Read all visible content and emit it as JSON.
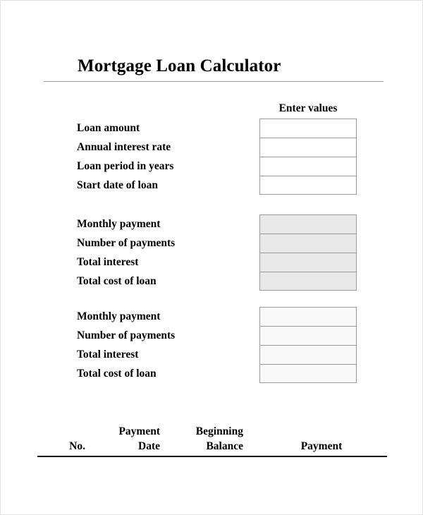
{
  "document": {
    "title": "Mortgage Loan Calculator"
  },
  "form": {
    "column_header": "Enter values",
    "groups": [
      {
        "id": "inputs",
        "style": "white",
        "rows": [
          {
            "label": "Loan amount",
            "value": "",
            "placeholder": ""
          },
          {
            "label": "Annual interest rate",
            "value": "",
            "placeholder": ""
          },
          {
            "label": "Loan period in years",
            "value": "",
            "placeholder": ""
          },
          {
            "label": "Start date of loan",
            "value": "",
            "placeholder": ""
          }
        ]
      },
      {
        "id": "results-shaded",
        "style": "gray",
        "rows": [
          {
            "label": "Monthly payment",
            "value": "",
            "placeholder": ""
          },
          {
            "label": "Number of payments",
            "value": "",
            "placeholder": ""
          },
          {
            "label": "Total interest",
            "value": "",
            "placeholder": ""
          },
          {
            "label": "Total cost of loan",
            "value": "",
            "placeholder": ""
          }
        ]
      },
      {
        "id": "results-light",
        "style": "light",
        "rows": [
          {
            "label": "Monthly payment",
            "value": "",
            "placeholder": ""
          },
          {
            "label": "Number of payments",
            "value": "",
            "placeholder": ""
          },
          {
            "label": "Total interest",
            "value": "",
            "placeholder": ""
          },
          {
            "label": "Total cost of loan",
            "value": "",
            "placeholder": ""
          }
        ]
      }
    ]
  },
  "amortization_table": {
    "columns": [
      {
        "line1": "",
        "line2": "No."
      },
      {
        "line1": "Payment",
        "line2": "Date"
      },
      {
        "line1": "Beginning",
        "line2": "Balance"
      },
      {
        "line1": "",
        "line2": "Payment"
      }
    ],
    "rows": []
  },
  "colors": {
    "page_border": "#e2e2e2",
    "rule_light": "#9a9a9a",
    "rule_dark": "#000000",
    "box_border": "#9a9a9a",
    "box_fill_white": "#ffffff",
    "box_fill_gray": "#e8e8e8",
    "box_fill_light": "#f9f9f9"
  }
}
